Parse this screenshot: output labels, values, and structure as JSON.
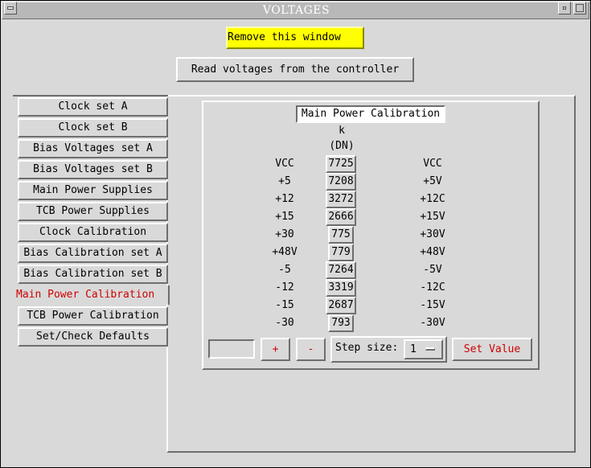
{
  "window": {
    "title": "VOLTAGES"
  },
  "toolbar": {
    "remove_label": "Remove this window",
    "read_label": "Read voltages from the controller"
  },
  "nav": {
    "items": [
      {
        "label": "Clock set A"
      },
      {
        "label": "Clock set B"
      },
      {
        "label": "Bias Voltages set A"
      },
      {
        "label": "Bias Voltages set B"
      },
      {
        "label": "Main Power Supplies"
      },
      {
        "label": "TCB Power Supplies"
      },
      {
        "label": "Clock Calibration"
      },
      {
        "label": "Bias Calibration set A"
      },
      {
        "label": "Bias Calibration set B"
      },
      {
        "label": "Main Power Calibration",
        "active": true
      },
      {
        "label": "TCB Power Calibration"
      },
      {
        "label": "Set/Check Defaults"
      }
    ]
  },
  "panel": {
    "title": "Main Power Calibration",
    "header_k": "k",
    "header_dn": "(DN)",
    "rows": [
      {
        "left": "VCC",
        "value": "7725",
        "right": "VCC"
      },
      {
        "left": "+5",
        "value": "7208",
        "right": "+5V"
      },
      {
        "left": "+12",
        "value": "3272",
        "right": "+12C"
      },
      {
        "left": "+15",
        "value": "2666",
        "right": "+15V"
      },
      {
        "left": "+30",
        "value": "775",
        "right": "+30V"
      },
      {
        "left": "+48V",
        "value": "779",
        "right": "+48V"
      },
      {
        "left": "-5",
        "value": "7264",
        "right": "-5V"
      },
      {
        "left": "-12",
        "value": "3319",
        "right": "-12C"
      },
      {
        "left": "-15",
        "value": "2687",
        "right": "-15V"
      },
      {
        "left": "-30",
        "value": "793",
        "right": "-30V"
      }
    ]
  },
  "controls": {
    "value_field": "",
    "plus_label": "+",
    "minus_label": "-",
    "step_label": "Step size:",
    "step_value": "1",
    "set_label": "Set Value"
  },
  "colors": {
    "accent_red": "#d00000",
    "highlight_yellow": "#ffff00",
    "bg_gray": "#d9d9d9"
  }
}
